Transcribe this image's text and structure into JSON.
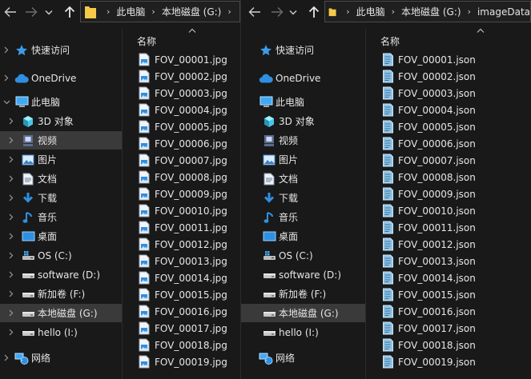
{
  "colors": {
    "background": "#191919",
    "selected": "#3a3a3a",
    "folder_yellow": "#f7c948",
    "accent_blue": "#2f8fe0",
    "text": "#e6e6e6"
  },
  "left": {
    "breadcrumb": [
      "此电脑",
      "本地磁盘 (G:)"
    ],
    "column_header": "名称",
    "nav": [
      {
        "label": "快速访问",
        "icon": "star-icon",
        "chevron": true,
        "selected": false
      },
      {
        "label": "OneDrive",
        "icon": "cloud-icon",
        "chevron": true,
        "selected": false
      },
      {
        "label": "此电脑",
        "icon": "computer-icon",
        "chevron": true,
        "expanded": true,
        "selected": false
      },
      {
        "label": "3D 对象",
        "icon": "cube-3d-icon",
        "chevron": true,
        "selected": false,
        "child": true
      },
      {
        "label": "视频",
        "icon": "video-icon",
        "chevron": true,
        "selected": true,
        "child": true
      },
      {
        "label": "图片",
        "icon": "pictures-icon",
        "chevron": true,
        "selected": false,
        "child": true
      },
      {
        "label": "文档",
        "icon": "documents-icon",
        "chevron": true,
        "selected": false,
        "child": true
      },
      {
        "label": "下载",
        "icon": "download-icon",
        "chevron": true,
        "selected": false,
        "child": true
      },
      {
        "label": "音乐",
        "icon": "music-icon",
        "chevron": true,
        "selected": false,
        "child": true
      },
      {
        "label": "桌面",
        "icon": "desktop-icon",
        "chevron": true,
        "selected": false,
        "child": true
      },
      {
        "label": "OS (C:)",
        "icon": "windows-drive-icon",
        "chevron": true,
        "selected": false,
        "child": true
      },
      {
        "label": "software (D:)",
        "icon": "drive-icon",
        "chevron": true,
        "selected": false,
        "child": true
      },
      {
        "label": "新加卷 (F:)",
        "icon": "drive-icon",
        "chevron": true,
        "selected": false,
        "child": true
      },
      {
        "label": "本地磁盘 (G:)",
        "icon": "drive-icon",
        "chevron": true,
        "selected": true,
        "child": true
      },
      {
        "label": "hello (I:)",
        "icon": "drive-icon",
        "chevron": true,
        "selected": false,
        "child": true
      },
      {
        "label": "网络",
        "icon": "network-icon",
        "chevron": true,
        "selected": false,
        "gap": true
      }
    ],
    "files": [
      "FOV_00001.jpg",
      "FOV_00002.jpg",
      "FOV_00003.jpg",
      "FOV_00004.jpg",
      "FOV_00005.jpg",
      "FOV_00006.jpg",
      "FOV_00007.jpg",
      "FOV_00008.jpg",
      "FOV_00009.jpg",
      "FOV_00010.jpg",
      "FOV_00011.jpg",
      "FOV_00012.jpg",
      "FOV_00013.jpg",
      "FOV_00014.jpg",
      "FOV_00015.jpg",
      "FOV_00016.jpg",
      "FOV_00017.jpg",
      "FOV_00018.jpg",
      "FOV_00019.jpg"
    ]
  },
  "right": {
    "breadcrumb": [
      "此电脑",
      "本地磁盘 (G:)",
      "imageData"
    ],
    "column_header": "名称",
    "nav": [
      {
        "label": "快速访问",
        "icon": "star-icon",
        "selected": false
      },
      {
        "label": "OneDrive",
        "icon": "cloud-icon",
        "selected": false
      },
      {
        "label": "此电脑",
        "icon": "computer-icon",
        "selected": false
      },
      {
        "label": "3D 对象",
        "icon": "cube-3d-icon",
        "selected": false,
        "child": true
      },
      {
        "label": "视频",
        "icon": "video-icon",
        "selected": false,
        "child": true
      },
      {
        "label": "图片",
        "icon": "pictures-icon",
        "selected": false,
        "child": true
      },
      {
        "label": "文档",
        "icon": "documents-icon",
        "selected": false,
        "child": true
      },
      {
        "label": "下载",
        "icon": "download-icon",
        "selected": false,
        "child": true
      },
      {
        "label": "音乐",
        "icon": "music-icon",
        "selected": false,
        "child": true
      },
      {
        "label": "桌面",
        "icon": "desktop-icon",
        "selected": false,
        "child": true
      },
      {
        "label": "OS (C:)",
        "icon": "windows-drive-icon",
        "selected": false,
        "child": true
      },
      {
        "label": "software (D:)",
        "icon": "drive-icon",
        "selected": false,
        "child": true
      },
      {
        "label": "新加卷 (F:)",
        "icon": "drive-icon",
        "selected": false,
        "child": true
      },
      {
        "label": "本地磁盘 (G:)",
        "icon": "drive-icon",
        "selected": true,
        "child": true
      },
      {
        "label": "hello (I:)",
        "icon": "drive-icon",
        "selected": false,
        "child": true
      },
      {
        "label": "网络",
        "icon": "network-icon",
        "selected": false,
        "gap": true
      }
    ],
    "files": [
      "FOV_00001.json",
      "FOV_00002.json",
      "FOV_00003.json",
      "FOV_00004.json",
      "FOV_00005.json",
      "FOV_00006.json",
      "FOV_00007.json",
      "FOV_00008.json",
      "FOV_00009.json",
      "FOV_00010.json",
      "FOV_00011.json",
      "FOV_00012.json",
      "FOV_00013.json",
      "FOV_00014.json",
      "FOV_00015.json",
      "FOV_00016.json",
      "FOV_00017.json",
      "FOV_00018.json",
      "FOV_00019.json"
    ]
  }
}
